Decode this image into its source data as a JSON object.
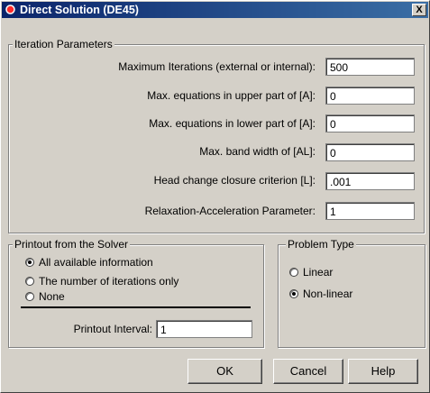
{
  "window": {
    "title": "Direct Solution (DE45)",
    "close_label": "X"
  },
  "iteration": {
    "legend": "Iteration Parameters",
    "rows": [
      {
        "label": "Maximum Iterations (external or internal):",
        "value": "500"
      },
      {
        "label": "Max. equations in upper part of [A]:",
        "value": "0"
      },
      {
        "label": "Max. equations in lower part of [A]:",
        "value": "0"
      },
      {
        "label": "Max. band width of [AL]:",
        "value": "0"
      },
      {
        "label": "Head change closure criterion [L]:",
        "value": ".001"
      },
      {
        "label": "Relaxation-Acceleration Parameter:",
        "value": "1"
      }
    ]
  },
  "printout": {
    "legend": "Printout from the Solver",
    "options": [
      {
        "label": "All available information",
        "selected": true
      },
      {
        "label": "The number of iterations only",
        "selected": false
      },
      {
        "label": "None",
        "selected": false
      }
    ],
    "interval_label": "Printout Interval:",
    "interval_value": "1"
  },
  "problem_type": {
    "legend": "Problem Type",
    "options": [
      {
        "label": "Linear",
        "selected": false
      },
      {
        "label": "Non-linear",
        "selected": true
      }
    ]
  },
  "buttons": {
    "ok": "OK",
    "cancel": "Cancel",
    "help": "Help"
  }
}
